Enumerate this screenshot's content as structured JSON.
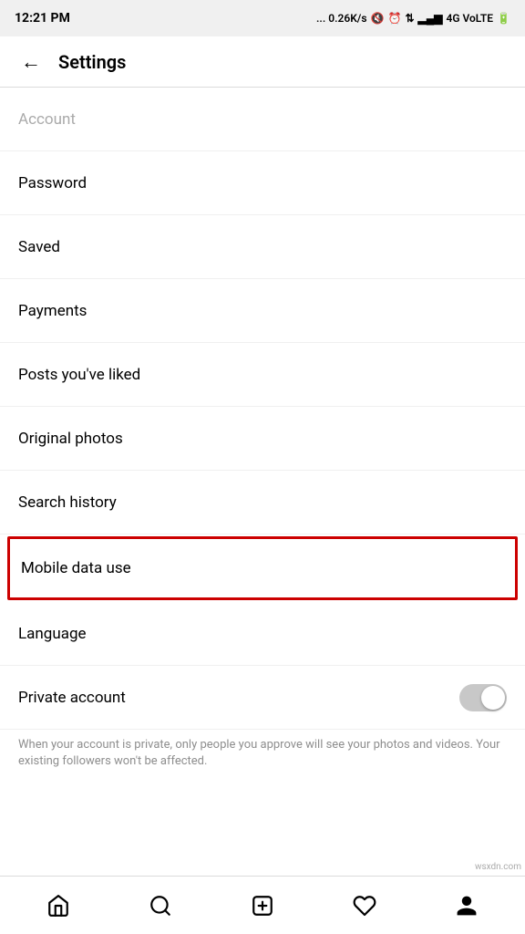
{
  "statusBar": {
    "time": "12:21 PM",
    "network": "... 0.26K/s",
    "networkType": "4G VoLTE"
  },
  "header": {
    "title": "Settings",
    "backLabel": "←"
  },
  "settingsItems": [
    {
      "id": "account",
      "label": "Account",
      "faded": true,
      "highlighted": false
    },
    {
      "id": "password",
      "label": "Password",
      "highlighted": false
    },
    {
      "id": "saved",
      "label": "Saved",
      "highlighted": false
    },
    {
      "id": "payments",
      "label": "Payments",
      "highlighted": false
    },
    {
      "id": "posts-liked",
      "label": "Posts you've liked",
      "highlighted": false
    },
    {
      "id": "original-photos",
      "label": "Original photos",
      "highlighted": false
    },
    {
      "id": "search-history",
      "label": "Search history",
      "highlighted": false
    },
    {
      "id": "mobile-data-use",
      "label": "Mobile data use",
      "highlighted": true
    },
    {
      "id": "language",
      "label": "Language",
      "highlighted": false
    }
  ],
  "privateAccount": {
    "label": "Private account",
    "description": "When your account is private, only people you approve will see your photos and videos. Your existing followers won't be affected.",
    "enabled": false
  },
  "bottomNav": {
    "items": [
      "home",
      "search",
      "add",
      "heart",
      "profile"
    ]
  },
  "watermark": "wsxdn.com"
}
